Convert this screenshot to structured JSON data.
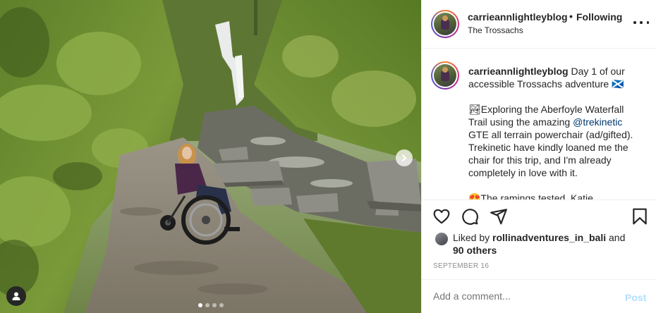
{
  "post": {
    "username": "carrieannlightleyblog",
    "separator": "•",
    "follow_state": "Following",
    "location": "The Trossachs"
  },
  "caption": {
    "username": "carrieannlightleyblog",
    "line1": "Day 1 of our accessible Trossachs adventure 🏴󠁧󠁢󠁳󠁣󠁴󠁿",
    "para2_pre": "🏞Exploring the Aberfoyle Waterfall Trail using the amazing ",
    "mention": "@trekinetic",
    "para2_post": " GTE all terrain powerchair (ad/gifted). Trekinetic have kindly loaned me the chair for this trip, and I'm already completely in love with it.",
    "para3": "😍The ramings tested. Katie"
  },
  "icons": {
    "like": "heart-icon",
    "comment": "comment-icon",
    "share": "share-icon",
    "save": "bookmark-icon",
    "more": "more-options-icon",
    "next": "chevron-right-icon",
    "tag": "user-tag-icon"
  },
  "likes": {
    "prefix": "Liked by ",
    "user": "rollinadventures_in_bali",
    "mid": " and",
    "others": "90 others"
  },
  "date": "SEPTEMBER 16",
  "comment": {
    "placeholder": "Add a comment...",
    "post_label": "Post"
  },
  "carousel": {
    "count": 4,
    "active_index": 0
  },
  "colors": {
    "text": "#262626",
    "muted": "#8e8e8e",
    "link": "#00376b",
    "post_disabled": "#b2dffc",
    "border": "#efefef"
  }
}
